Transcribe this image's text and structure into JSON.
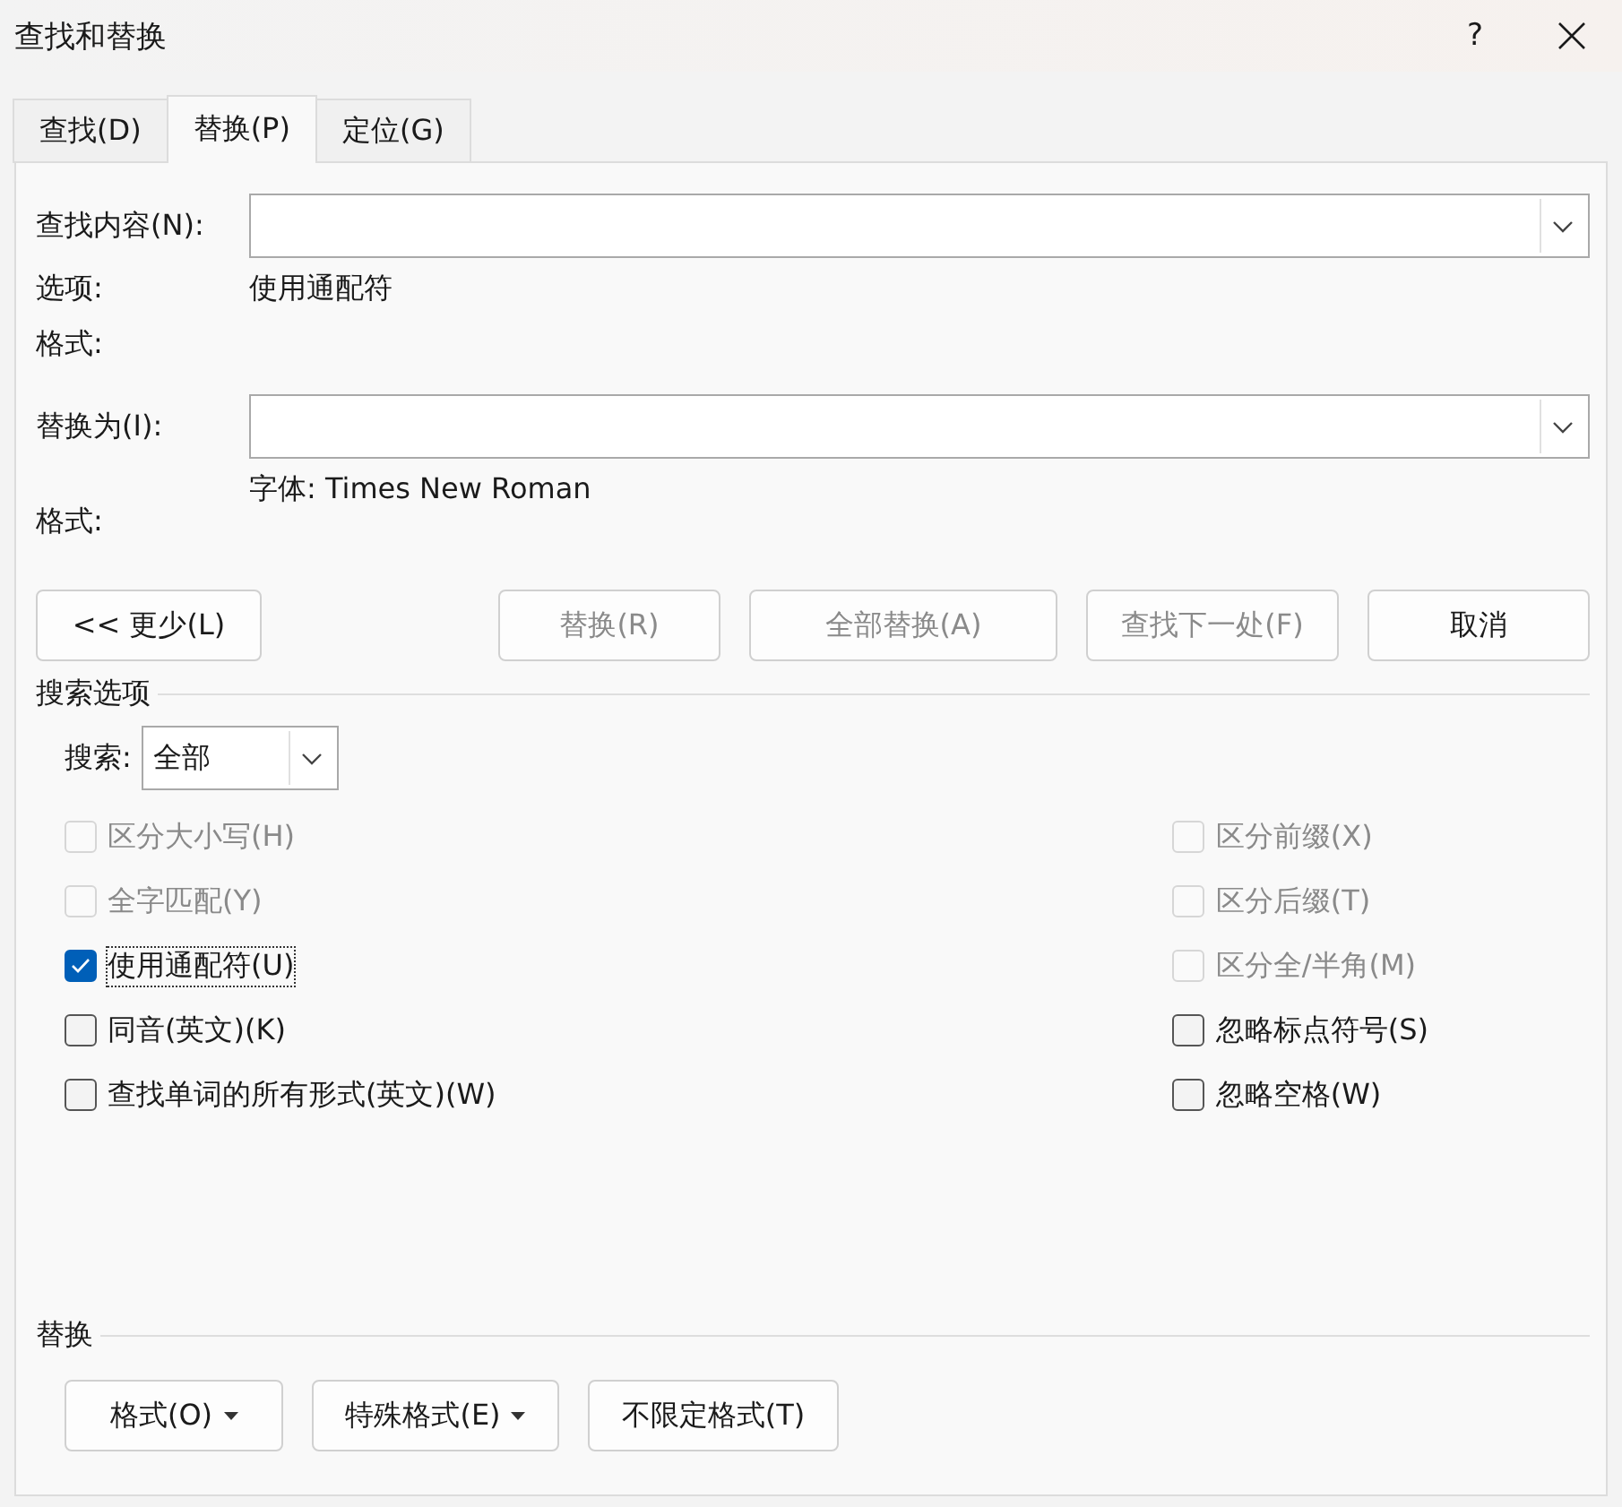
{
  "window": {
    "title": "查找和替换",
    "help": "?"
  },
  "tabs": [
    {
      "label": "查找(D)",
      "selected": false
    },
    {
      "label": "替换(P)",
      "selected": true
    },
    {
      "label": "定位(G)",
      "selected": false
    }
  ],
  "find": {
    "label": "查找内容(N):",
    "options_label": "选项:",
    "options_value": "使用通配符",
    "format_label": "格式:"
  },
  "replace": {
    "label": "替换为(I):",
    "format_label": "格式:",
    "format_value": "字体: Times New Roman"
  },
  "actions": [
    {
      "label": "<< 更少(L)",
      "disabled": false,
      "kind": "left"
    },
    {
      "label": "替换(R)",
      "disabled": true,
      "kind": "right"
    },
    {
      "label": "全部替换(A)",
      "disabled": true,
      "kind": "right"
    },
    {
      "label": "查找下一处(F)",
      "disabled": true,
      "kind": "right"
    },
    {
      "label": "取消",
      "disabled": false,
      "kind": "right"
    }
  ],
  "search_options": {
    "title": "搜索选项",
    "search_label": "搜索:",
    "search_value": "全部"
  },
  "left_options": [
    {
      "label": "区分大小写(H)",
      "checked": false,
      "disabled": true,
      "focused": false
    },
    {
      "label": "全字匹配(Y)",
      "checked": false,
      "disabled": true,
      "focused": false
    },
    {
      "label": "使用通配符(U)",
      "checked": true,
      "disabled": false,
      "focused": true
    },
    {
      "label": "同音(英文)(K)",
      "checked": false,
      "disabled": false,
      "focused": false
    },
    {
      "label": "查找单词的所有形式(英文)(W)",
      "checked": false,
      "disabled": false,
      "focused": false
    }
  ],
  "right_options": [
    {
      "label": "区分前缀(X)",
      "checked": false,
      "disabled": true,
      "focused": false
    },
    {
      "label": "区分后缀(T)",
      "checked": false,
      "disabled": true,
      "focused": false
    },
    {
      "label": "区分全/半角(M)",
      "checked": false,
      "disabled": true,
      "focused": false
    },
    {
      "label": "忽略标点符号(S)",
      "checked": false,
      "disabled": false,
      "focused": false
    },
    {
      "label": "忽略空格(W)",
      "checked": false,
      "disabled": false,
      "focused": false
    }
  ],
  "replace_section": {
    "title": "替换",
    "buttons": [
      {
        "label": "格式(O)",
        "has_menu": true
      },
      {
        "label": "特殊格式(E)",
        "has_menu": true
      },
      {
        "label": "不限定格式(T)",
        "has_menu": false
      }
    ]
  }
}
